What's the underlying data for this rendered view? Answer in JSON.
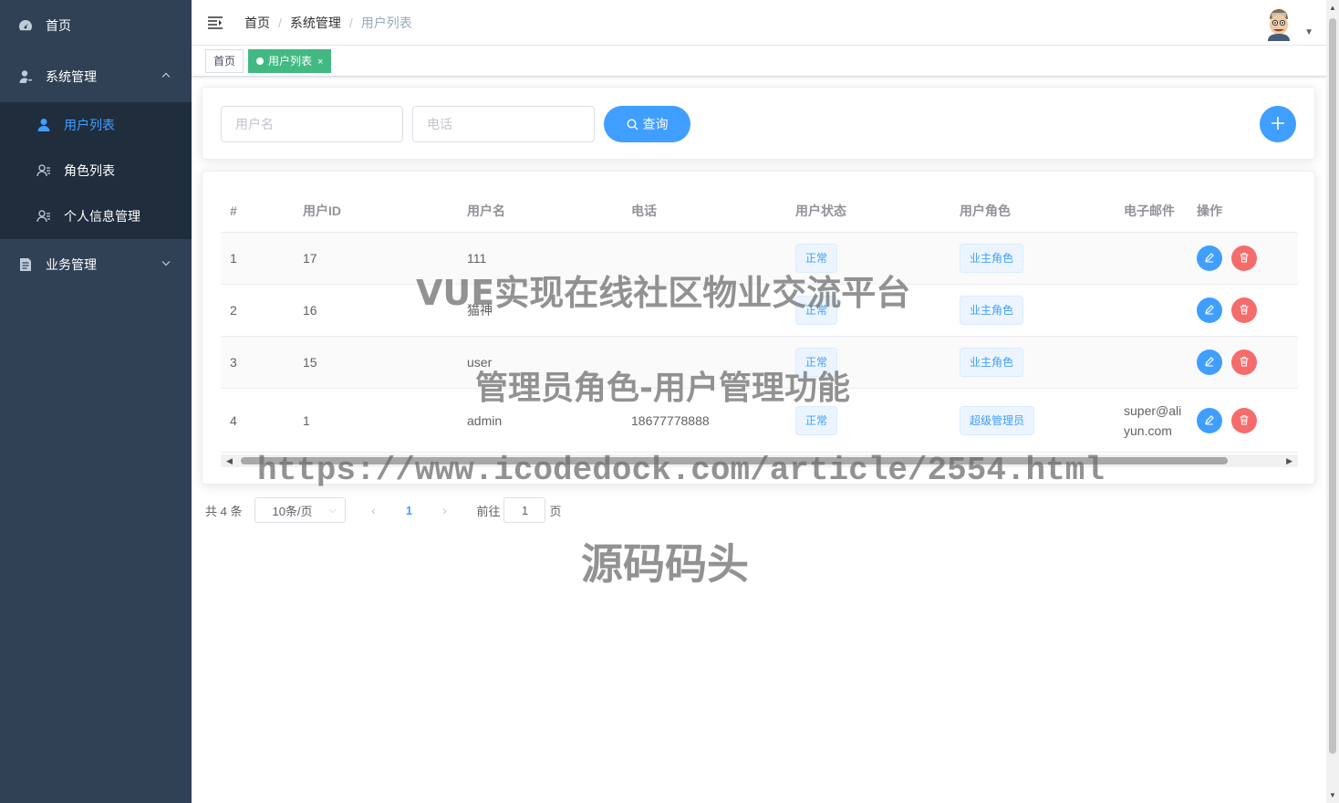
{
  "sidebar": {
    "home": {
      "label": "首页",
      "icon": "dashboard-icon"
    },
    "system": {
      "label": "系统管理",
      "icon": "user-admin-icon",
      "expanded": true,
      "children": [
        {
          "label": "用户列表",
          "icon": "user-icon",
          "active": true
        },
        {
          "label": "角色列表",
          "icon": "role-list-icon"
        },
        {
          "label": "个人信息管理",
          "icon": "profile-icon"
        }
      ]
    },
    "business": {
      "label": "业务管理",
      "icon": "document-icon",
      "expanded": false
    }
  },
  "header": {
    "breadcrumb": [
      "首页",
      "系统管理",
      "用户列表"
    ]
  },
  "tags": [
    {
      "label": "首页",
      "active": false
    },
    {
      "label": "用户列表",
      "active": true,
      "close": "×"
    }
  ],
  "search": {
    "username_placeholder": "用户名",
    "phone_placeholder": "电话",
    "query_label": "查询",
    "add_label": "+"
  },
  "table": {
    "columns": [
      "#",
      "用户ID",
      "用户名",
      "电话",
      "用户状态",
      "用户角色",
      "电子邮件",
      "操作"
    ],
    "rows": [
      {
        "index": "1",
        "id": "17",
        "username": "111",
        "phone": "",
        "status": "正常",
        "role": "业主角色",
        "email": ""
      },
      {
        "index": "2",
        "id": "16",
        "username": "猫神",
        "phone": "",
        "status": "正常",
        "role": "业主角色",
        "email": ""
      },
      {
        "index": "3",
        "id": "15",
        "username": "user",
        "phone": "",
        "status": "正常",
        "role": "业主角色",
        "email": ""
      },
      {
        "index": "4",
        "id": "1",
        "username": "admin",
        "phone": "18677778888",
        "status": "正常",
        "role": "超级管理员",
        "email": "super@aliyun.com"
      }
    ]
  },
  "pagination": {
    "total": "共 4 条",
    "page_size": "10条/页",
    "current_page": "1",
    "goto_prefix": "前往",
    "goto_value": "1",
    "goto_suffix": "页"
  },
  "watermarks": {
    "line1": "VUE实现在线社区物业交流平台",
    "line2": "管理员角色-用户管理功能",
    "line3": "https://www.icodedock.com/article/2554.html",
    "line4": "源码码头"
  },
  "colors": {
    "sidebar_bg": "#304156",
    "submenu_bg": "#1f2d3d",
    "primary": "#409eff",
    "danger": "#f56c6c",
    "tag_active": "#42b983"
  }
}
